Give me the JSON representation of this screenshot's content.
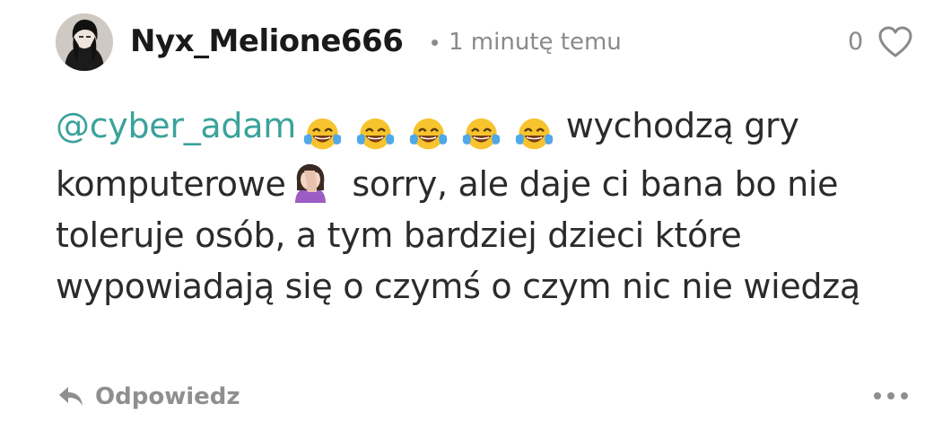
{
  "comment": {
    "username": "Nyx_Melione666",
    "separator": "•",
    "timestamp": "1 minutę temu",
    "likes": "0",
    "mention": "@cyber_adam",
    "text_part1": " wychodzą gry komputerowe",
    "text_part2": " sorry, ale daje ci bana bo nie toleruje osób, a tym bardziej dzieci które wypowiadają się o czymś o czym nic nie wiedzą",
    "emojis": [
      "face-with-tears-of-joy-icon",
      "face-with-tears-of-joy-icon",
      "face-with-tears-of-joy-icon",
      "face-with-tears-of-joy-icon",
      "face-with-tears-of-joy-icon",
      "woman-facepalming-icon"
    ]
  },
  "actions": {
    "reply_label": "Odpowiedz"
  },
  "colors": {
    "mention": "#3aa39a",
    "muted": "#8a8a8a",
    "text": "#2b2b2b"
  }
}
